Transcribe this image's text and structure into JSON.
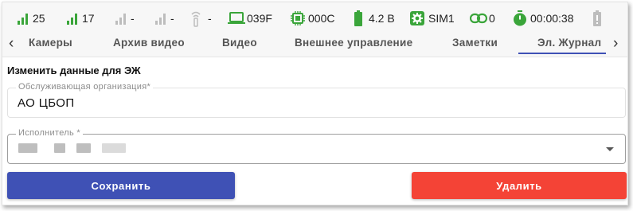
{
  "status_bar": {
    "signal_1": {
      "value": "25",
      "icon": "signal-bars-icon",
      "color": "#3aa53a"
    },
    "signal_2": {
      "value": "17",
      "icon": "signal-bars-icon",
      "color": "#3aa53a"
    },
    "signal_3": {
      "value": "-",
      "icon": "signal-bars-icon",
      "color": "#bdbdbd"
    },
    "signal_4": {
      "value": "-",
      "icon": "signal-bars-icon",
      "color": "#bdbdbd"
    },
    "wifi": {
      "value": "-",
      "icon": "wifi-icon",
      "color": "#bdbdbd"
    },
    "laptop": {
      "value": "039F",
      "icon": "laptop-icon",
      "color": "#3aa53a"
    },
    "cpu": {
      "value": "000C",
      "icon": "chip-icon",
      "color": "#3aa53a"
    },
    "battery": {
      "value": "4.2 В",
      "icon": "battery-icon",
      "color": "#3aa53a"
    },
    "sim": {
      "value": "SIM1",
      "icon": "gear-icon",
      "color": "#3aa53a"
    },
    "link": {
      "value": "0",
      "icon": "link-icon",
      "color": "#3aa53a"
    },
    "timer": {
      "value": "00:00:38",
      "icon": "stopwatch-icon",
      "color": "#3aa53a"
    },
    "battery_2": {
      "icon": "battery-icon",
      "color": "#bdbdbd"
    }
  },
  "tabs": [
    {
      "label": "Камеры"
    },
    {
      "label": "Архив видео"
    },
    {
      "label": "Видео"
    },
    {
      "label": "Внешнее управление"
    },
    {
      "label": "Заметки"
    },
    {
      "label": "Эл. Журнал",
      "active": true
    }
  ],
  "form": {
    "title": "Изменить данные для ЭЖ",
    "organization": {
      "label": "Обслуживающая организация*",
      "value": "АО ЦБОП"
    },
    "executor": {
      "label": "Исполнитель *"
    }
  },
  "buttons": {
    "save": "Сохранить",
    "delete": "Удалить"
  },
  "colors": {
    "accent": "#3f51b5",
    "danger": "#f44336",
    "status_green": "#3aa53a"
  }
}
